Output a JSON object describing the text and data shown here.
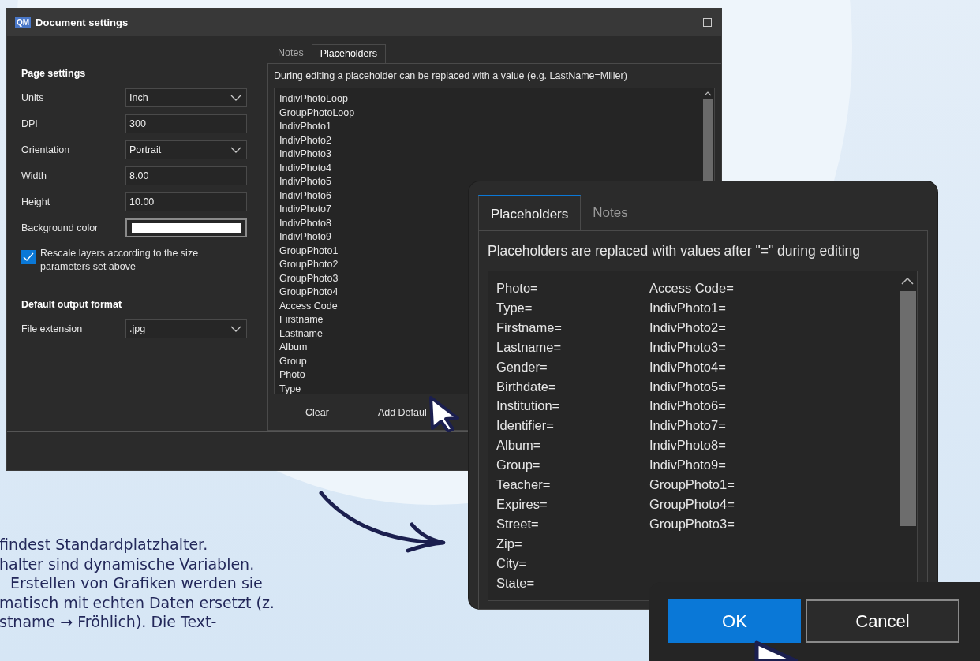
{
  "back_window": {
    "app_icon_text": "QM",
    "title": "Document settings",
    "page_settings": {
      "heading": "Page settings",
      "fields": [
        {
          "label": "Units",
          "kind": "dropdown",
          "value": "Inch"
        },
        {
          "label": "DPI",
          "kind": "text",
          "value": "300"
        },
        {
          "label": "Orientation",
          "kind": "dropdown",
          "value": "Portrait"
        },
        {
          "label": "Width",
          "kind": "text",
          "value": "8.00"
        },
        {
          "label": "Height",
          "kind": "text",
          "value": "10.00"
        },
        {
          "label": "Background color",
          "kind": "color",
          "color": "#ffffff"
        }
      ]
    },
    "rescale": {
      "label": "Rescale layers according to the size parameters set above",
      "checked": true
    },
    "output": {
      "heading": "Default output format",
      "fields": [
        {
          "label": "File extension",
          "kind": "dropdown",
          "value": ".jpg"
        }
      ]
    },
    "tabs": [
      {
        "label": "Notes",
        "selected": false
      },
      {
        "label": "Placeholders",
        "selected": true
      }
    ],
    "description": "During editing a placeholder can be replaced with a value (e.g. LastName=Miller)",
    "placeholders": [
      "IndivPhotoLoop",
      "GroupPhotoLoop",
      "IndivPhoto1",
      "IndivPhoto2",
      "IndivPhoto3",
      "IndivPhoto4",
      "IndivPhoto5",
      "IndivPhoto6",
      "IndivPhoto7",
      "IndivPhoto8",
      "IndivPhoto9",
      "GroupPhoto1",
      "GroupPhoto2",
      "GroupPhoto3",
      "GroupPhoto4",
      "Access Code",
      "Firstname",
      "Lastname",
      "Album",
      "Group",
      "Photo",
      "Type"
    ],
    "buttons": [
      "Clear",
      "Add Defaul"
    ]
  },
  "front_window": {
    "tabs": [
      {
        "label": "Placeholders",
        "selected": true
      },
      {
        "label": "Notes",
        "selected": false
      }
    ],
    "description": "Placeholders are replaced with values after \"=\" during editing",
    "columns": [
      [
        "Photo=",
        "Type=",
        "Firstname=",
        "Lastname=",
        "Gender=",
        "Birthdate=",
        "Institution=",
        "Identifier=",
        "Album=",
        "Group=",
        "Teacher=",
        "Expires=",
        "Street=",
        "Zip=",
        "City=",
        "State="
      ],
      [
        "Access Code=",
        "IndivPhoto1=",
        "IndivPhoto2=",
        "IndivPhoto3=",
        "IndivPhoto4=",
        "IndivPhoto5=",
        "IndivPhoto6=",
        "IndivPhoto7=",
        "IndivPhoto8=",
        "IndivPhoto9=",
        "GroupPhoto1=",
        "GroupPhoto4=",
        "GroupPhoto3="
      ]
    ]
  },
  "dialog_buttons": [
    {
      "label": "OK",
      "kind": "primary"
    },
    {
      "label": "Cancel",
      "kind": "secondary"
    }
  ],
  "caption_lines": [
    "findest Standardplatzhalter.",
    "halter sind dynamische Variablen.",
    "Erstellen von Grafiken werden sie",
    "matisch mit echten Daten ersetzt (z.",
    "stname → Fröhlich). Die Text-"
  ]
}
